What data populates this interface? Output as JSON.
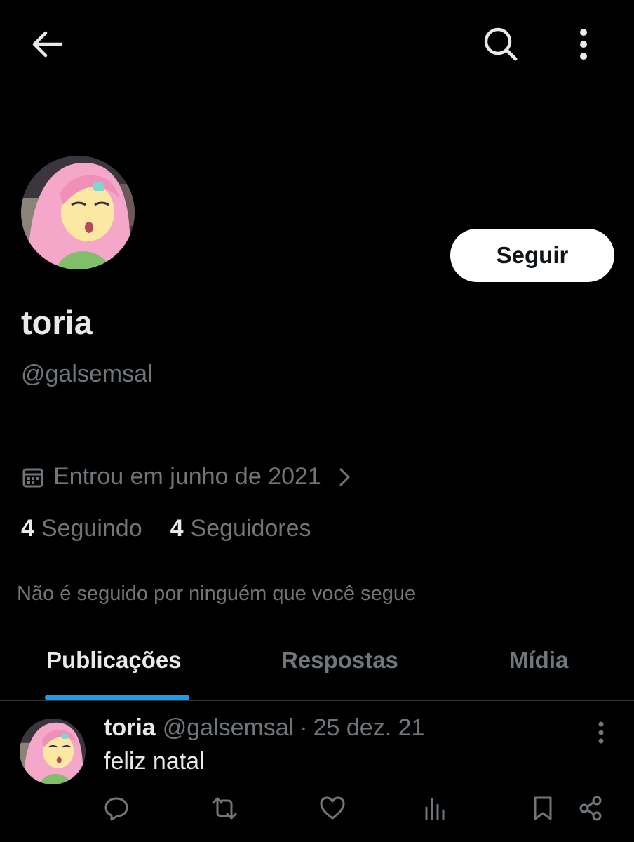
{
  "header": {
    "back_icon": "arrow-left-icon",
    "search_icon": "search-icon",
    "more_icon": "more-vertical-icon"
  },
  "profile": {
    "display_name": "toria",
    "handle": "@galsemsal",
    "follow_label": "Seguir",
    "joined_text": "Entrou em junho de 2021",
    "following_count": "4",
    "following_label": "Seguindo",
    "followers_count": "4",
    "followers_label": "Seguidores",
    "not_followed_text": "Não é seguido por ninguém que você segue"
  },
  "tabs": [
    {
      "label": "Publicações",
      "active": true
    },
    {
      "label": "Respostas",
      "active": false
    },
    {
      "label": "Mídia",
      "active": false
    }
  ],
  "post": {
    "name": "toria",
    "handle": "@galsemsal",
    "separator": "·",
    "date": "25 dez. 21",
    "text": "feliz natal",
    "actions": [
      "reply-icon",
      "repost-icon",
      "like-icon",
      "views-icon",
      "bookmark-icon",
      "share-icon"
    ]
  },
  "colors": {
    "background": "#000000",
    "text_primary": "#e7e9ea",
    "text_secondary": "#71767b",
    "accent": "#1d9bf0",
    "divider": "#2f3336",
    "button_bg": "#ffffff"
  }
}
